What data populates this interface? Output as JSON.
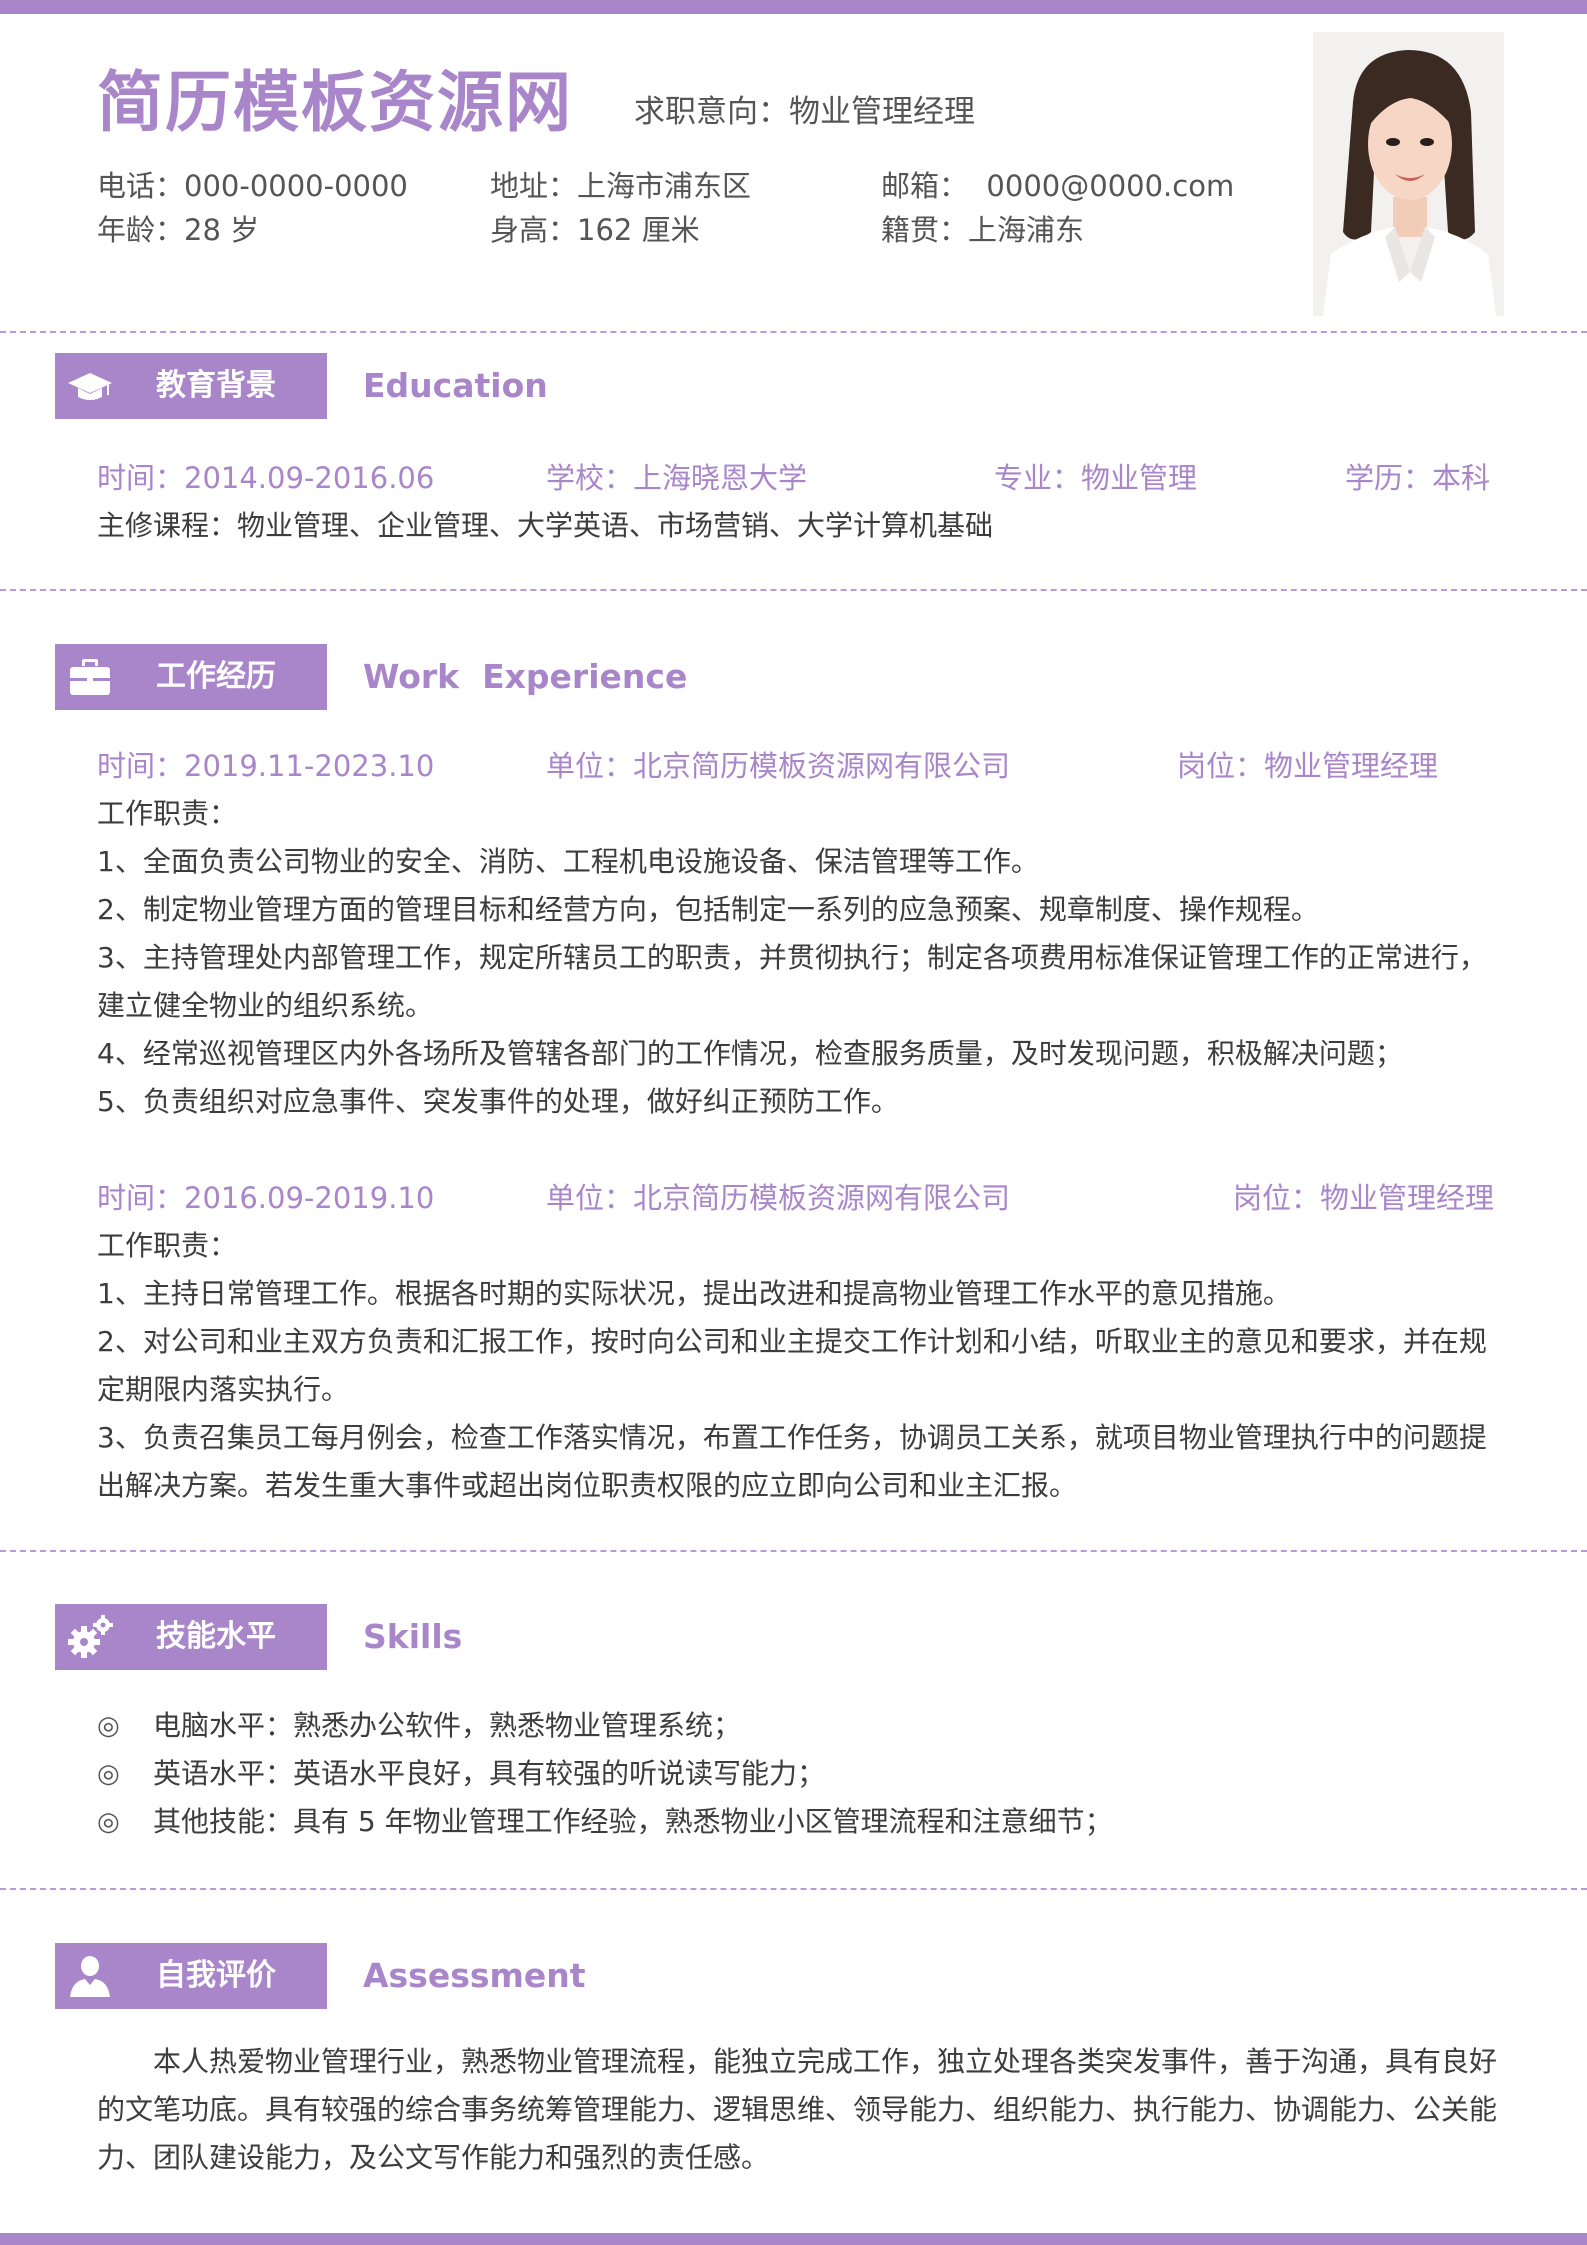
{
  "header": {
    "name": "简历模板资源网",
    "intent": "求职意向：物业管理经理",
    "phone": "电话：000-0000-0000",
    "address": "地址：上海市浦东区",
    "email": "邮箱：  0000@0000.com",
    "age": "年龄：28 岁",
    "height": "身高：162 厘米",
    "origin": "籍贯：上海浦东"
  },
  "theme": {
    "accent": "#a985c9",
    "text": "#3d3d3d",
    "divider": "#b99ad6"
  },
  "education": {
    "title_zh": "教育背景",
    "title_en": "Education",
    "icon": "graduation-cap-icon",
    "time": "时间：2014.09-2016.06",
    "school": "学校：上海晓恩大学",
    "major": "专业：物业管理",
    "degree": "学历：本科",
    "courses": "主修课程：物业管理、企业管理、大学英语、市场营销、大学计算机基础"
  },
  "work": {
    "title_zh": "工作经历",
    "title_en": "Work  Experience",
    "icon": "briefcase-icon",
    "jobs": [
      {
        "time": "时间：2019.11-2023.10",
        "company": "单位：北京简历模板资源网有限公司",
        "position": "岗位：物业管理经理",
        "duties_label": "工作职责：",
        "duties": [
          "1、全面负责公司物业的安全、消防、工程机电设施设备、保洁管理等工作。",
          "2、制定物业管理方面的管理目标和经营方向，包括制定一系列的应急预案、规章制度、操作规程。",
          "3、主持管理处内部管理工作，规定所辖员工的职责，并贯彻执行；制定各项费用标准保证管理工作的正常进行，建立健全物业的组织系统。",
          "4、经常巡视管理区内外各场所及管辖各部门的工作情况，检查服务质量，及时发现问题，积极解决问题；",
          "5、负责组织对应急事件、突发事件的处理，做好纠正预防工作。"
        ]
      },
      {
        "time": "时间：2016.09-2019.10",
        "company": "单位：北京简历模板资源网有限公司",
        "position": "岗位：物业管理经理",
        "duties_label": "工作职责：",
        "duties": [
          "1、主持日常管理工作。根据各时期的实际状况，提出改进和提高物业管理工作水平的意见措施。",
          "2、对公司和业主双方负责和汇报工作，按时向公司和业主提交工作计划和小结，听取业主的意见和要求，并在规定期限内落实执行。",
          "3、负责召集员工每月例会，检查工作落实情况，布置工作任务，协调员工关系，就项目物业管理执行中的问题提出解决方案。若发生重大事件或超出岗位职责权限的应立即向公司和业主汇报。"
        ]
      }
    ]
  },
  "skills": {
    "title_zh": "技能水平",
    "title_en": "Skills",
    "icon": "gears-icon",
    "bullet": "◎",
    "items": [
      "电脑水平：熟悉办公软件，熟悉物业管理系统；",
      "英语水平：英语水平良好，具有较强的听说读写能力；",
      "其他技能：具有 5 年物业管理工作经验，熟悉物业小区管理流程和注意细节；"
    ]
  },
  "assessment": {
    "title_zh": "自我评价",
    "title_en": "Assessment",
    "icon": "user-icon",
    "text": "本人热爱物业管理行业，熟悉物业管理流程，能独立完成工作，独立处理各类突发事件，善于沟通，具有良好的文笔功底。具有较强的综合事务统筹管理能力、逻辑思维、领导能力、组织能力、执行能力、协调能力、公关能力、团队建设能力，及公文写作能力和强烈的责任感。"
  }
}
